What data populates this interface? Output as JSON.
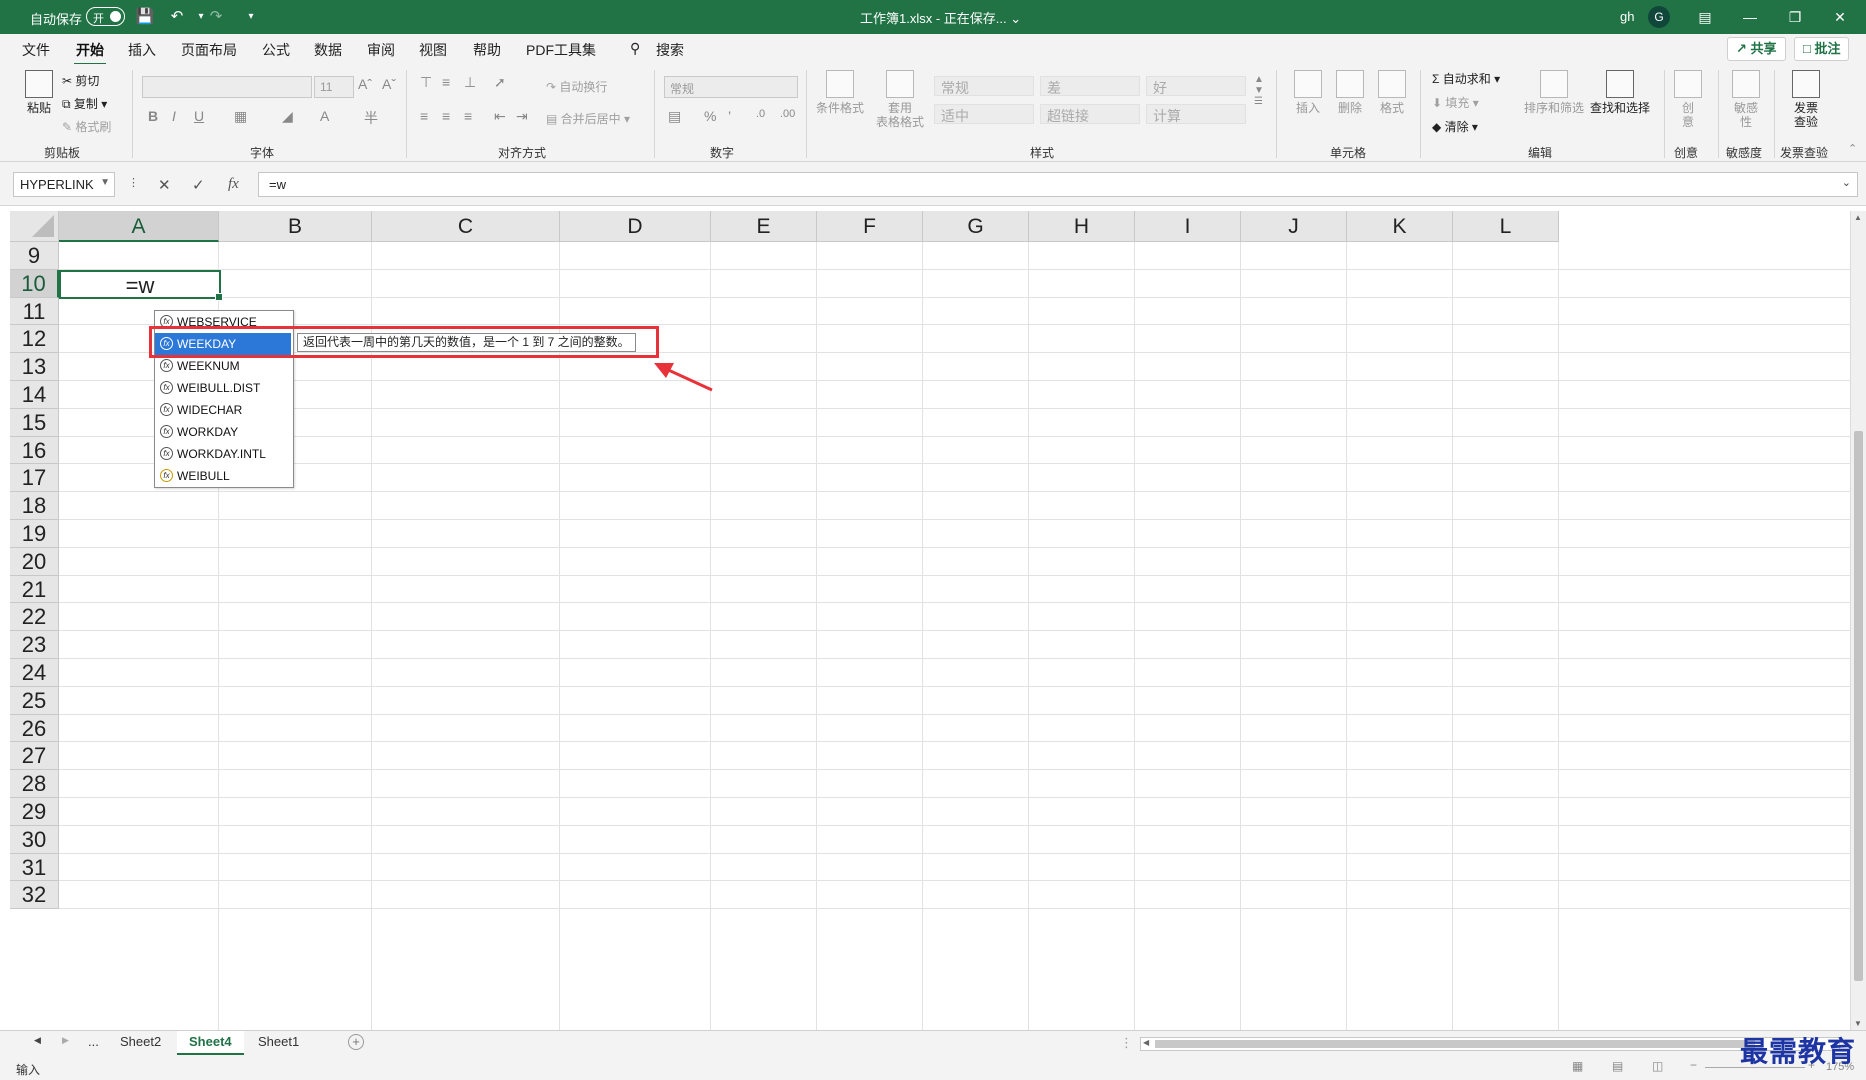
{
  "titlebar": {
    "autosave_label": "自动保存",
    "autosave_state": "开",
    "title": "工作簿1.xlsx - 正在保存... ⌄",
    "user": "gh",
    "avatar": "G"
  },
  "menu": {
    "tabs": [
      "文件",
      "开始",
      "插入",
      "页面布局",
      "公式",
      "数据",
      "审阅",
      "视图",
      "帮助",
      "PDF工具集"
    ],
    "active": "开始",
    "search": "搜索",
    "share": "共享",
    "comment": "批注"
  },
  "ribbon": {
    "clipboard": {
      "paste": "粘贴",
      "cut": "剪切",
      "copy": "复制",
      "format_painter": "格式刷",
      "group": "剪贴板"
    },
    "font": {
      "font_size": "11",
      "group": "字体"
    },
    "alignment": {
      "wrap": "自动换行",
      "merge": "合并后居中",
      "group": "对齐方式"
    },
    "number": {
      "format": "常规",
      "group": "数字"
    },
    "styles": {
      "conditional": "条件格式",
      "table": "套用\n表格格式",
      "cells": [
        "常规",
        "差",
        "好",
        "适中",
        "超链接",
        "计算"
      ],
      "group": "样式"
    },
    "cells": {
      "insert": "插入",
      "delete": "删除",
      "format": "格式",
      "group": "单元格"
    },
    "editing": {
      "autosum": "自动求和",
      "fill": "填充",
      "clear": "清除",
      "sort": "排序和筛选",
      "find": "查找和选择",
      "group": "编辑"
    },
    "creative": {
      "label": "创意",
      "btn": "创\n意"
    },
    "sensitivity": {
      "label": "敏感度",
      "btn": "敏感\n性"
    },
    "invoice": {
      "label": "发票查验",
      "btn": "发票\n查验"
    }
  },
  "formula_bar": {
    "name_box": "HYPERLINK",
    "formula": "=w"
  },
  "grid": {
    "columns": [
      "A",
      "B",
      "C",
      "D",
      "E",
      "F",
      "G",
      "H",
      "I",
      "J",
      "K",
      "L"
    ],
    "rows": [
      "9",
      "10",
      "11",
      "12",
      "13",
      "14",
      "15",
      "16",
      "17",
      "18",
      "19",
      "20",
      "21",
      "22",
      "23",
      "24",
      "25",
      "26",
      "27",
      "28",
      "29",
      "30",
      "31",
      "32"
    ],
    "active_cell_value": "=w"
  },
  "autocomplete": {
    "items": [
      "WEBSERVICE",
      "WEEKDAY",
      "WEEKNUM",
      "WEIBULL.DIST",
      "WIDECHAR",
      "WORKDAY",
      "WORKDAY.INTL",
      "WEIBULL"
    ],
    "highlighted": "WEEKDAY",
    "tooltip": "返回代表一周中的第几天的数值，是一个 1 到 7 之间的整数。"
  },
  "sheets": {
    "nav_more": "...",
    "tabs": [
      "Sheet2",
      "Sheet4",
      "Sheet1"
    ],
    "active": "Sheet4"
  },
  "status": {
    "mode": "输入",
    "zoom": "175%"
  },
  "watermark": "最需教育",
  "colors": {
    "excel_green": "#217346",
    "highlight": "#2b78d8",
    "annotation_red": "#e8323a"
  }
}
